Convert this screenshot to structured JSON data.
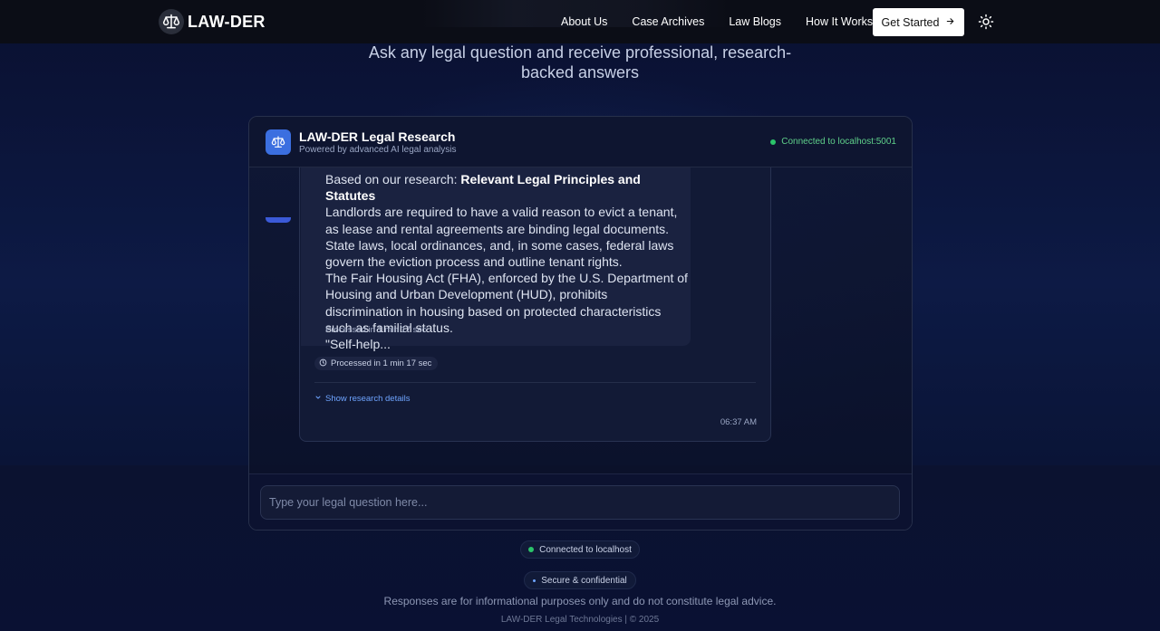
{
  "nav": {
    "logo_text": "LAW-DER",
    "links": [
      "About Us",
      "Case Archives",
      "Law Blogs",
      "How It Works"
    ],
    "cta_label": "Get Started"
  },
  "hero": {
    "subtitle": "Ask any legal question and receive professional, research-backed answers"
  },
  "chat": {
    "title": "LAW-DER Legal Research",
    "subtitle": "Powered by advanced AI legal analysis",
    "connection_status": "Connected to localhost:5001",
    "message": {
      "intro": "Based on our research: ",
      "heading": "Relevant Legal Principles and Statutes",
      "paragraphs": [
        "Landlords are required to have a valid reason to evict a tenant, as lease and rental agreements are binding legal documents.",
        "State laws, local ordinances, and, in some cases, federal laws govern the eviction process and outline tenant rights.",
        "The Fair Housing Act (FHA), enforced by the U.S. Department of Housing and Urban Development (HUD), prohibits discrimination in housing based on protected characteristics such as familial status.",
        "\"Self-help..."
      ],
      "processed_inner": "Processed in 1 min 17 sec",
      "processed_badge": "Processed in 1 min 17 sec",
      "research_toggle": "Show research details",
      "time": "06:37 AM"
    },
    "input_placeholder": "Type your legal question here..."
  },
  "footer": {
    "status_connected": "Connected to localhost",
    "status_secure": "Secure & confidential",
    "disclaimer": "Responses are for informational purposes only and do not constitute legal advice.",
    "copyright": "LAW-DER Legal Technologies | © 2025"
  },
  "colors": {
    "accent": "#3b6fe0",
    "link": "#6ea4ff",
    "status_green": "#2bc46a",
    "background": "#0d1a45"
  }
}
